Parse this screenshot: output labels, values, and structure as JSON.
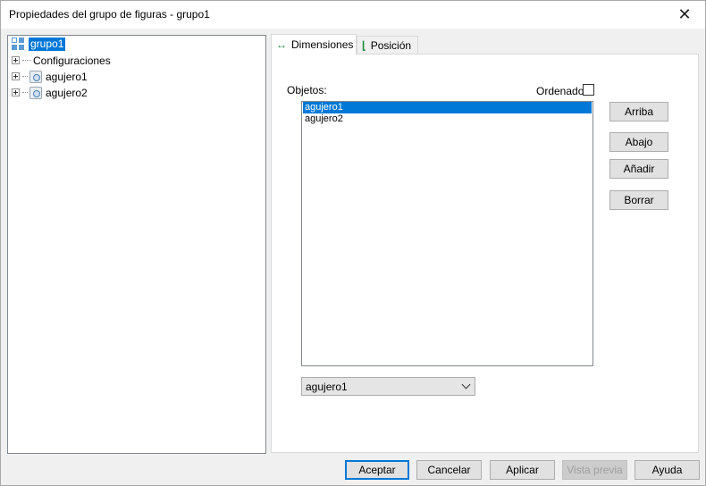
{
  "window": {
    "title": "Propiedades del grupo de figuras - grupo1",
    "close": "✕"
  },
  "tree": {
    "root": "grupo1",
    "items": [
      {
        "label": "Configuraciones"
      },
      {
        "label": "agujero1"
      },
      {
        "label": "agujero2"
      }
    ]
  },
  "tabs": [
    {
      "label": "Dimensiones",
      "icon": "dimension-arrows-icon"
    },
    {
      "label": "Posición",
      "icon": "position-axes-icon"
    }
  ],
  "dimensions": {
    "objects_label": "Objetos:",
    "ordered_label": "Ordenado",
    "ordered_checked": false,
    "list": [
      "agujero1",
      "agujero2"
    ],
    "selected": "agujero1",
    "buttons": {
      "up": "Arriba",
      "down": "Abajo",
      "add": "Añadir",
      "delete": "Borrar"
    },
    "combo_value": "agujero1"
  },
  "footer": {
    "accept": "Aceptar",
    "cancel": "Cancelar",
    "apply": "Aplicar",
    "preview": "Vista previa",
    "help": "Ayuda"
  },
  "colors": {
    "selection": "#0078d7",
    "tab_icon": "#1b8a3a",
    "group_icon": "#5b9bd5"
  }
}
